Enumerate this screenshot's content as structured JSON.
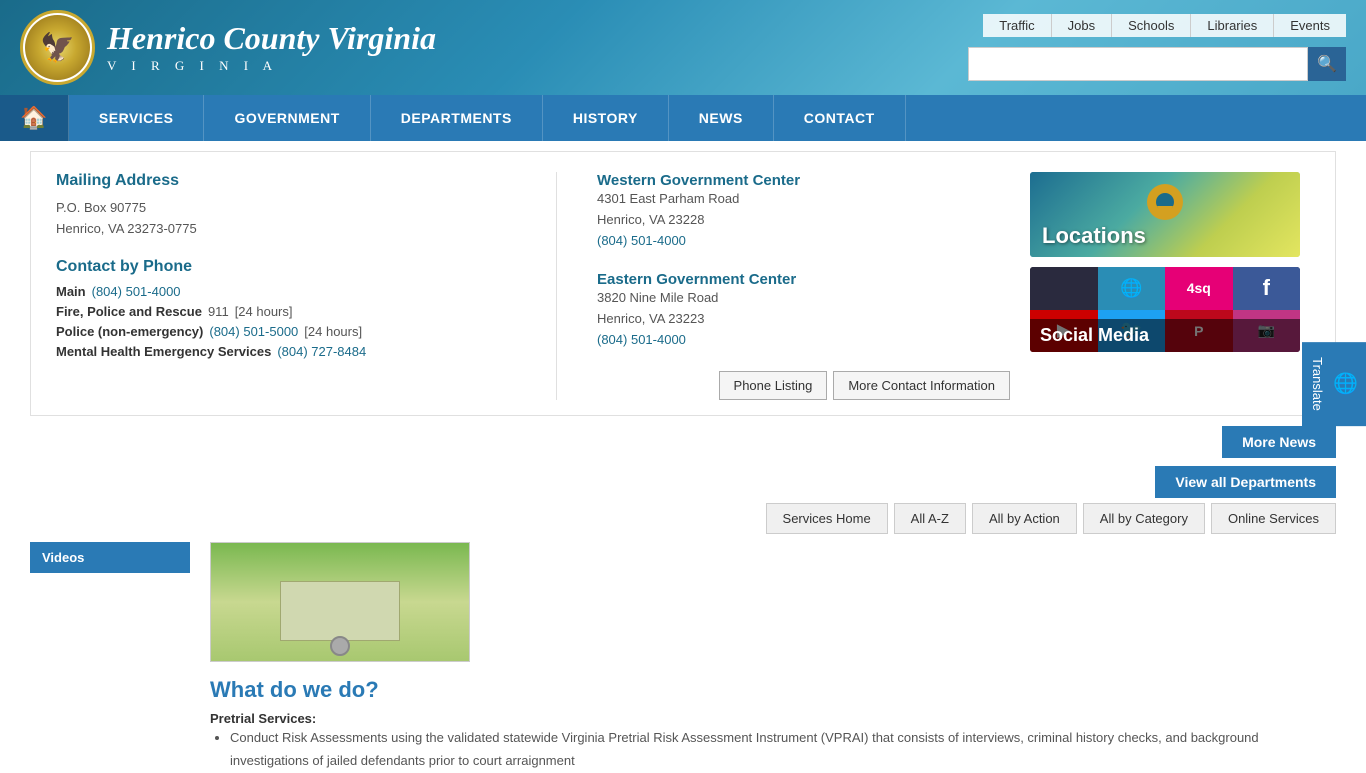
{
  "header": {
    "title": "Henrico County Virginia",
    "top_links": [
      "Traffic",
      "Jobs",
      "Schools",
      "Libraries",
      "Events"
    ],
    "search_placeholder": ""
  },
  "nav": {
    "items": [
      "SERVICES",
      "GOVERNMENT",
      "DEPARTMENTS",
      "HISTORY",
      "NEWS",
      "CONTACT"
    ]
  },
  "contact_panel": {
    "mailing_title": "Mailing Address",
    "mailing_line1": "P.O. Box 90775",
    "mailing_line2": "Henrico, VA 23273-0775",
    "phone_title": "Contact by Phone",
    "phones": [
      {
        "label": "Main",
        "number": "(804) 501-4000",
        "extra": ""
      },
      {
        "label": "Fire, Police and Rescue",
        "number": "911",
        "extra": "[24 hours]"
      },
      {
        "label": "Police (non-emergency)",
        "number": "(804) 501-5000",
        "extra": "[24 hours]"
      },
      {
        "label": "Mental Health Emergency Services",
        "number": "(804) 727-8484",
        "extra": ""
      }
    ],
    "western_title": "Western Government Center",
    "western_addr1": "4301 East Parham Road",
    "western_addr2": "Henrico, VA 23228",
    "western_phone": "(804) 501-4000",
    "eastern_title": "Eastern Government Center",
    "eastern_addr1": "3820 Nine Mile Road",
    "eastern_addr2": "Henrico, VA 23223",
    "eastern_phone": "(804) 501-4000",
    "btn_phone": "Phone Listing",
    "btn_more": "More Contact Information"
  },
  "widgets": {
    "locations_label": "Locations",
    "social_label": "Social Media"
  },
  "bars": {
    "more_news": "More News",
    "view_all_depts": "View all Departments",
    "services_home": "Services Home",
    "all_az": "All A-Z",
    "all_by_action": "All by Action",
    "all_by_category": "All by Category",
    "online_services": "Online Services"
  },
  "sidebar": {
    "item": "Videos"
  },
  "content": {
    "heading": "What do we do?",
    "dept_label": "Pretrial Services:",
    "intro": "Conduct Risk Assessments using the validated statewide Virginia Pretrial Risk Assessment Instrument (VPRAI) that consists of interviews, criminal history checks, and background investigations of jailed defendants prior to court arraignment"
  },
  "translate": {
    "label": "Translate"
  }
}
